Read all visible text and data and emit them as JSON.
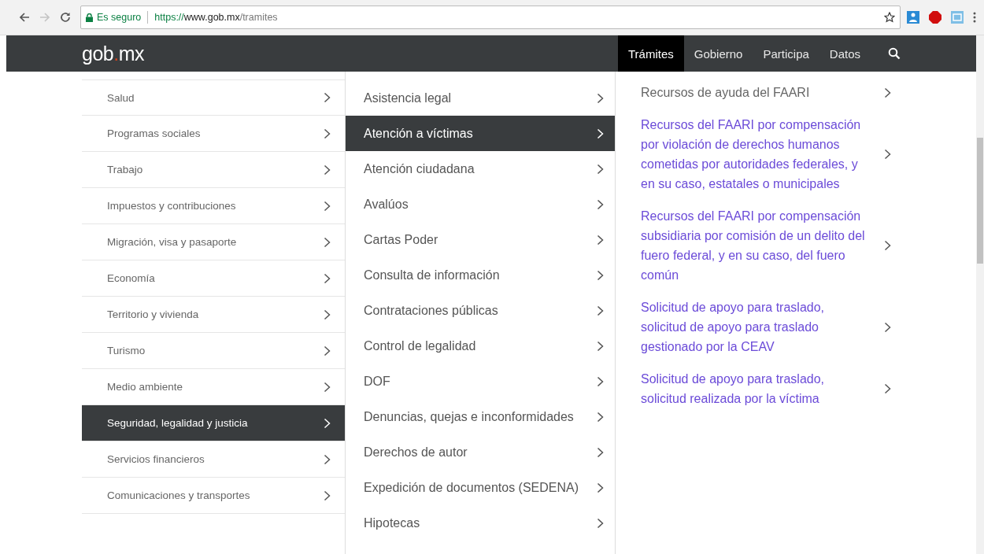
{
  "browser": {
    "security_label": "Es seguro",
    "url_scheme": "https://",
    "url_host": "www.gob.mx",
    "url_path": "/tramites",
    "forward_disabled": true
  },
  "header": {
    "logo_left": "gob",
    "logo_dot": ".",
    "logo_right": "mx",
    "nav": [
      {
        "label": "Trámites",
        "selected": true
      },
      {
        "label": "Gobierno",
        "selected": false
      },
      {
        "label": "Participa",
        "selected": false
      },
      {
        "label": "Datos",
        "selected": false
      }
    ]
  },
  "categories": [
    {
      "label": "Salud",
      "selected": false
    },
    {
      "label": "Programas sociales",
      "selected": false
    },
    {
      "label": "Trabajo",
      "selected": false
    },
    {
      "label": "Impuestos y contribuciones",
      "selected": false
    },
    {
      "label": "Migración, visa y pasaporte",
      "selected": false
    },
    {
      "label": "Economía",
      "selected": false
    },
    {
      "label": "Territorio y vivienda",
      "selected": false
    },
    {
      "label": "Turismo",
      "selected": false
    },
    {
      "label": "Medio ambiente",
      "selected": false
    },
    {
      "label": "Seguridad, legalidad y justicia",
      "selected": true
    },
    {
      "label": "Servicios financieros",
      "selected": false
    },
    {
      "label": "Comunicaciones y transportes",
      "selected": false
    }
  ],
  "subcategories": [
    {
      "label": "Asistencia legal",
      "selected": false
    },
    {
      "label": "Atención a víctimas",
      "selected": true
    },
    {
      "label": "Atención ciudadana",
      "selected": false
    },
    {
      "label": "Avalúos",
      "selected": false
    },
    {
      "label": "Cartas Poder",
      "selected": false
    },
    {
      "label": "Consulta de información",
      "selected": false
    },
    {
      "label": "Contrataciones públicas",
      "selected": false
    },
    {
      "label": "Control de legalidad",
      "selected": false
    },
    {
      "label": "DOF",
      "selected": false
    },
    {
      "label": "Denuncias, quejas e inconformidades",
      "selected": false
    },
    {
      "label": "Derechos de autor",
      "selected": false
    },
    {
      "label": "Expedición de documentos (SEDENA)",
      "selected": false
    },
    {
      "label": "Hipotecas",
      "selected": false
    }
  ],
  "procedures": [
    {
      "label": "Recursos de ayuda del FAARI",
      "visited": false
    },
    {
      "label": "Recursos del FAARI por compensación por violación de derechos humanos cometidas por autoridades federales, y en su caso, estatales o municipales",
      "visited": true
    },
    {
      "label": "Recursos del FAARI por compensación subsidiaria por comisión de un delito del fuero federal, y en su caso, del fuero común",
      "visited": true
    },
    {
      "label": "Solicitud de apoyo para traslado, solicitud de apoyo para traslado gestionado por la CEAV",
      "visited": true
    },
    {
      "label": "Solicitud de apoyo para traslado, solicitud realizada por la víctima",
      "visited": true
    }
  ]
}
